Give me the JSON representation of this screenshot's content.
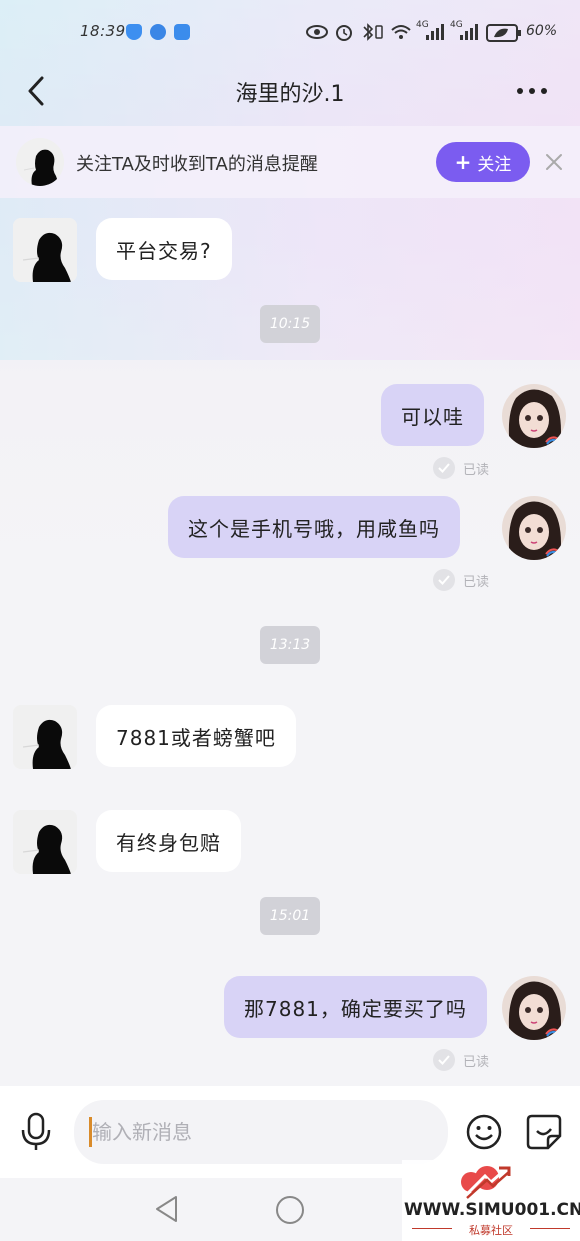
{
  "status_bar": {
    "time": "18:39",
    "battery": "60%",
    "network_1": "4G",
    "network_2": "4G"
  },
  "header": {
    "title": "海里的沙.1",
    "back_icon": "chevron-left-icon",
    "more_icon": "more-dots-icon"
  },
  "follow_bar": {
    "text": "关注TA及时收到TA的消息提醒",
    "button_label": "关注",
    "button_color": "#7b5cf0"
  },
  "messages": [
    {
      "side": "in",
      "text": "平台交易?"
    },
    {
      "side": "time",
      "text": "10:15"
    },
    {
      "side": "out",
      "text": "可以哇",
      "read": "已读"
    },
    {
      "side": "out",
      "text": "这个是手机号哦，用咸鱼吗",
      "read": "已读"
    },
    {
      "side": "time",
      "text": "13:13"
    },
    {
      "side": "in",
      "text": "7881或者螃蟹吧"
    },
    {
      "side": "in",
      "text": "有终身包赔"
    },
    {
      "side": "time",
      "text": "15:01"
    },
    {
      "side": "out",
      "text": "那7881，确定要买了吗",
      "read": "已读"
    }
  ],
  "input": {
    "placeholder": "输入新消息"
  },
  "watermark": {
    "url": "WWW.SIMU001.CN",
    "label": "私募社区"
  },
  "colors": {
    "outgoing_bubble": "#d8d3f6",
    "incoming_bubble": "#ffffff",
    "accent": "#7b5cf0"
  }
}
